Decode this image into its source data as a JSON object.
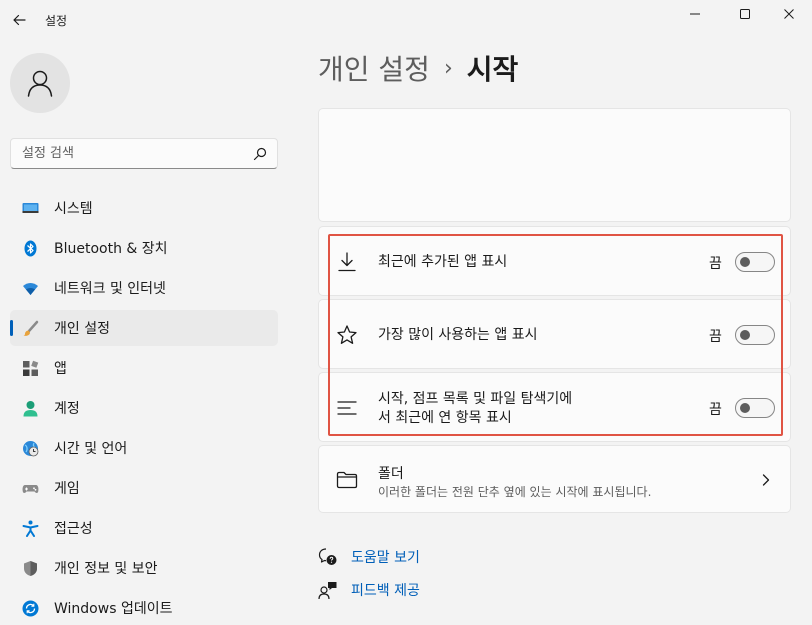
{
  "window": {
    "title": "설정"
  },
  "search": {
    "placeholder": "설정 검색"
  },
  "sidebar": {
    "items": [
      {
        "label": "시스템",
        "icon": "monitor-icon"
      },
      {
        "label": "Bluetooth & 장치",
        "icon": "bluetooth-icon"
      },
      {
        "label": "네트워크 및 인터넷",
        "icon": "wifi-icon"
      },
      {
        "label": "개인 설정",
        "icon": "brush-icon",
        "active": true
      },
      {
        "label": "앱",
        "icon": "apps-icon"
      },
      {
        "label": "계정",
        "icon": "person-icon"
      },
      {
        "label": "시간 및 언어",
        "icon": "clock-globe-icon"
      },
      {
        "label": "게임",
        "icon": "gamepad-icon"
      },
      {
        "label": "접근성",
        "icon": "accessibility-icon"
      },
      {
        "label": "개인 정보 및 보안",
        "icon": "shield-icon"
      },
      {
        "label": "Windows 업데이트",
        "icon": "update-icon"
      }
    ]
  },
  "breadcrumb": {
    "parent": "개인 설정",
    "separator": "›",
    "current": "시작"
  },
  "settings": [
    {
      "label": "최근에 추가된 앱 표시",
      "state": "끔",
      "on": false,
      "icon": "download-icon"
    },
    {
      "label": "가장 많이 사용하는 앱 표시",
      "state": "끔",
      "on": false,
      "icon": "star-icon"
    },
    {
      "label_line1": "시작, 점프 목록 및 파일 탐색기에",
      "label_line2": "서 최근에 연 항목 표시",
      "state": "끔",
      "on": false,
      "icon": "list-icon"
    }
  ],
  "folders": {
    "title": "폴더",
    "description": "이러한 폴더는 전원 단추 옆에 있는 시작에 표시됩니다.",
    "icon": "folder-icon"
  },
  "links": [
    {
      "label": "도움말 보기",
      "icon": "help-icon"
    },
    {
      "label": "피드백 제공",
      "icon": "feedback-icon"
    }
  ],
  "colors": {
    "accent": "#005fb8",
    "highlight": "#e05444"
  }
}
